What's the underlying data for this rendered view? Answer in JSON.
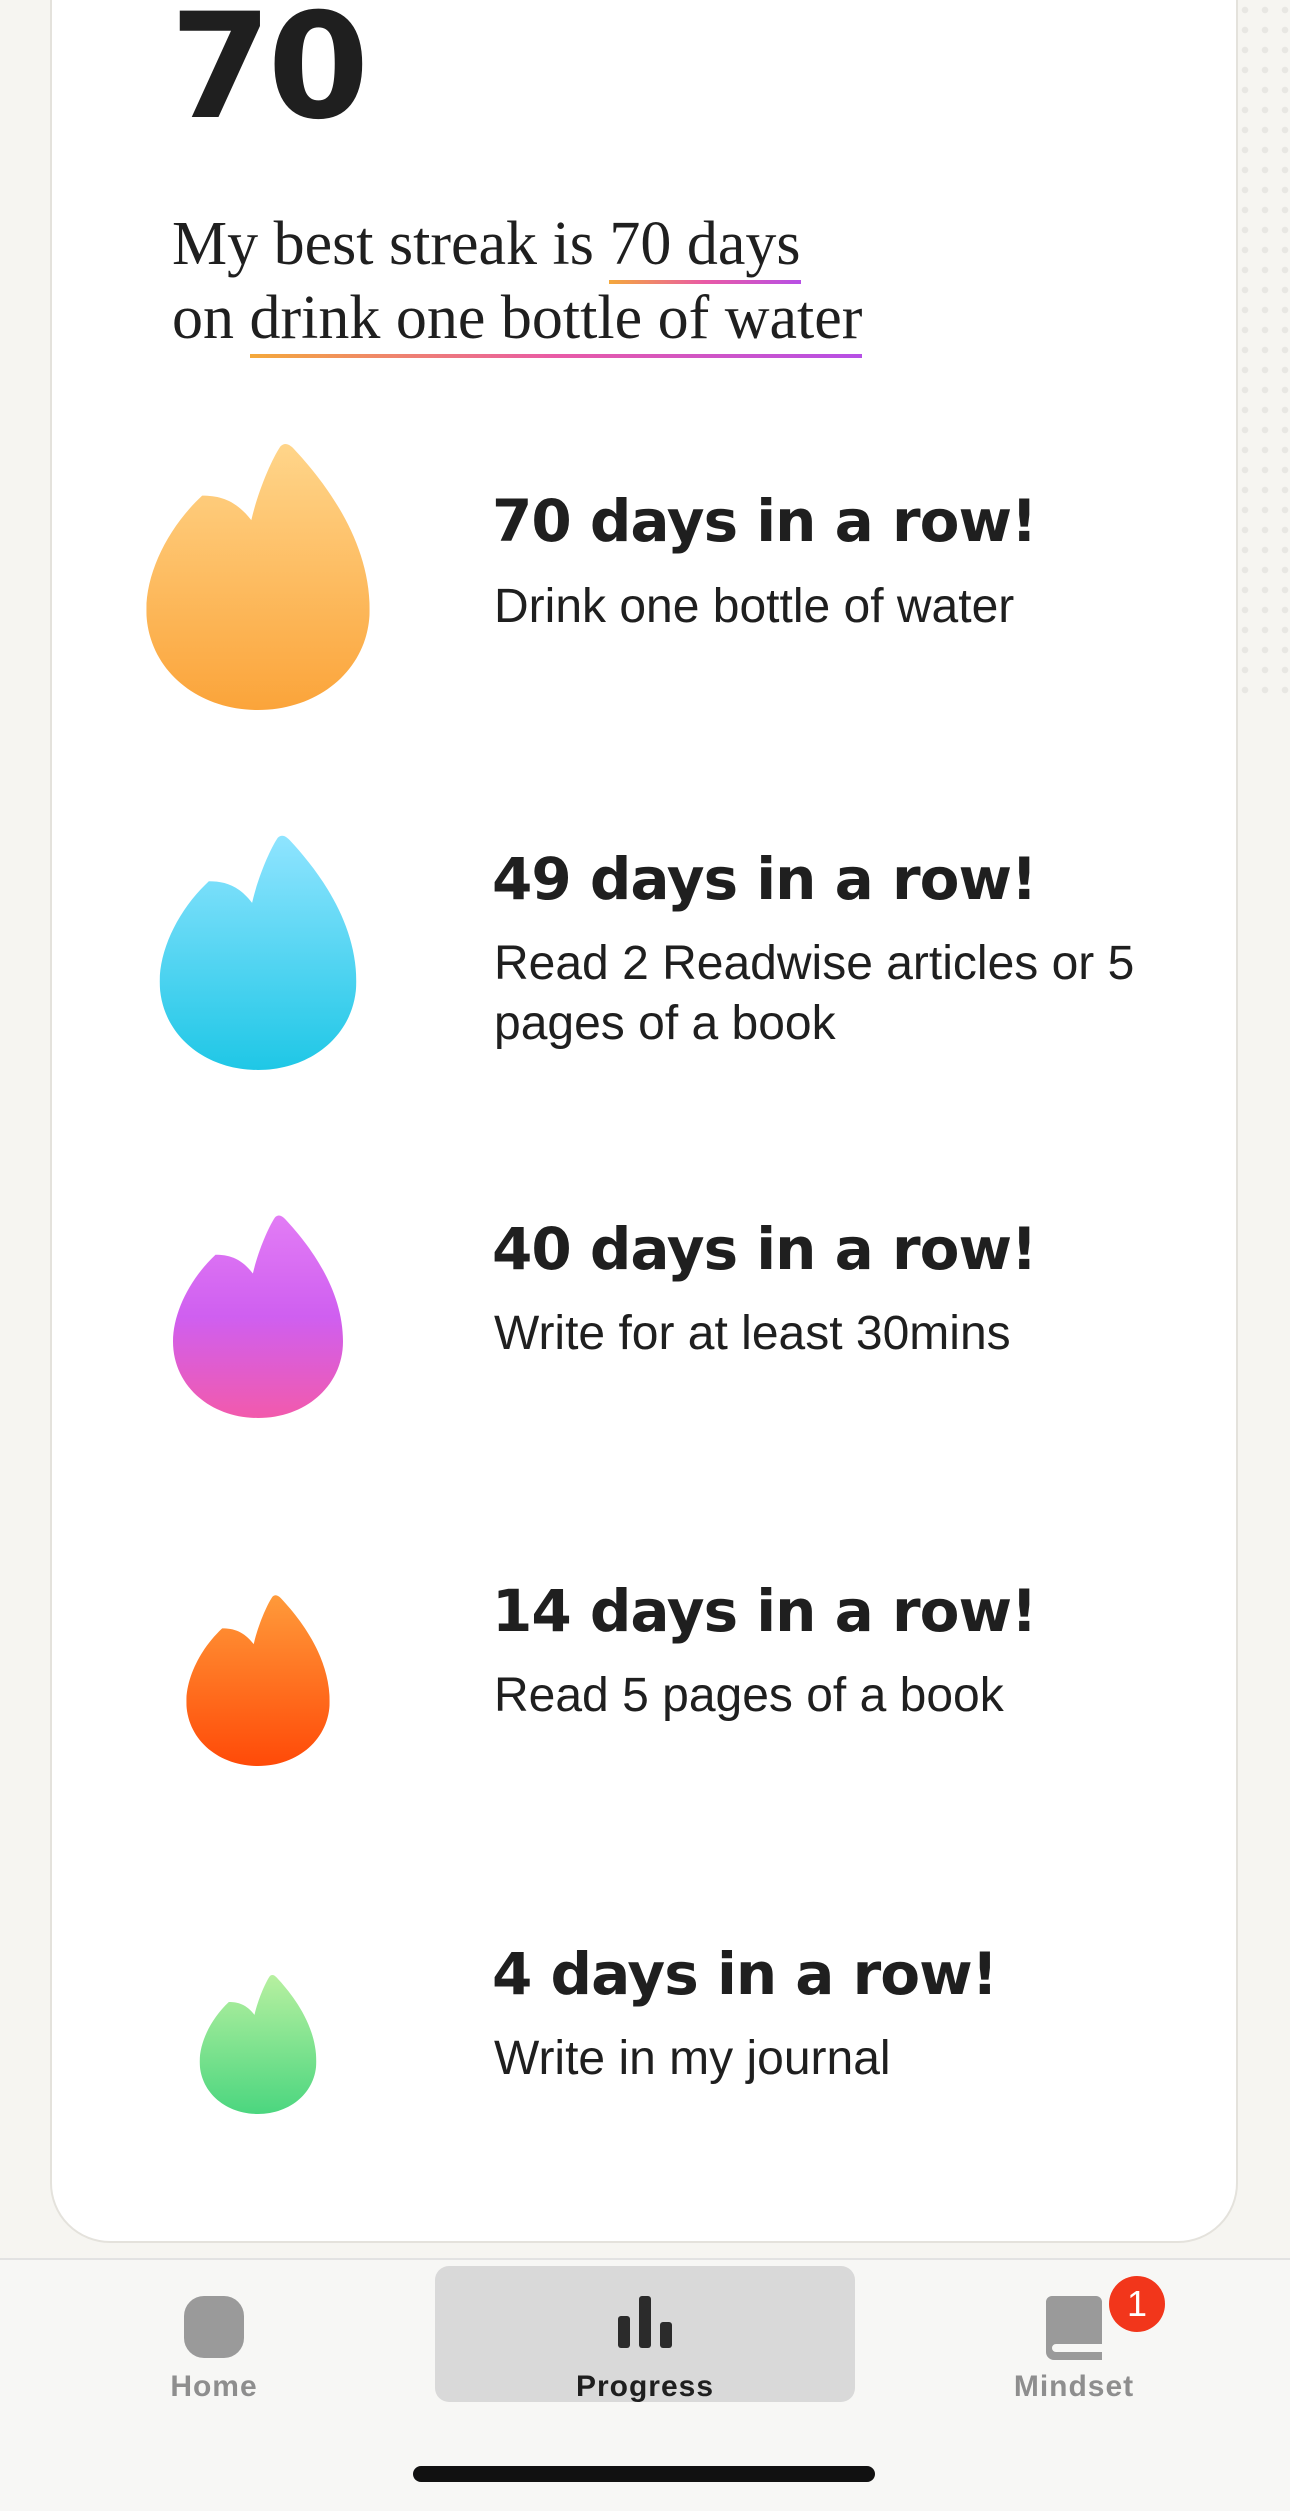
{
  "summary": {
    "best_streak_number": "70",
    "sentence_prefix_1": "My best streak is ",
    "sentence_highlight_1": "70 days",
    "sentence_prefix_2": "on ",
    "sentence_highlight_2": "drink one bottle of water"
  },
  "streaks": [
    {
      "title": "70 days in a row!",
      "habit": "Drink one bottle of water",
      "flame_color": "orange"
    },
    {
      "title": "49 days in a row!",
      "habit": "Read 2 Readwise articles or 5 pages of a book",
      "flame_color": "blue"
    },
    {
      "title": "40 days in a row!",
      "habit": "Write for at least 30mins",
      "flame_color": "purple"
    },
    {
      "title": "14 days in a row!",
      "habit": "Read 5 pages of a book",
      "flame_color": "red-orange"
    },
    {
      "title": "4 days in a row!",
      "habit": "Write in my journal",
      "flame_color": "green"
    }
  ],
  "tabbar": {
    "tabs": [
      {
        "label": "Home",
        "icon": "home-icon",
        "active": false
      },
      {
        "label": "Progress",
        "icon": "bar-chart-icon",
        "active": true
      },
      {
        "label": "Mindset",
        "icon": "book-icon",
        "active": false,
        "badge": "1"
      }
    ]
  },
  "colors": {
    "accent_gradient": [
      "#f4a93a",
      "#e95aa6",
      "#b64fe6"
    ],
    "badge": "#f2361b"
  }
}
